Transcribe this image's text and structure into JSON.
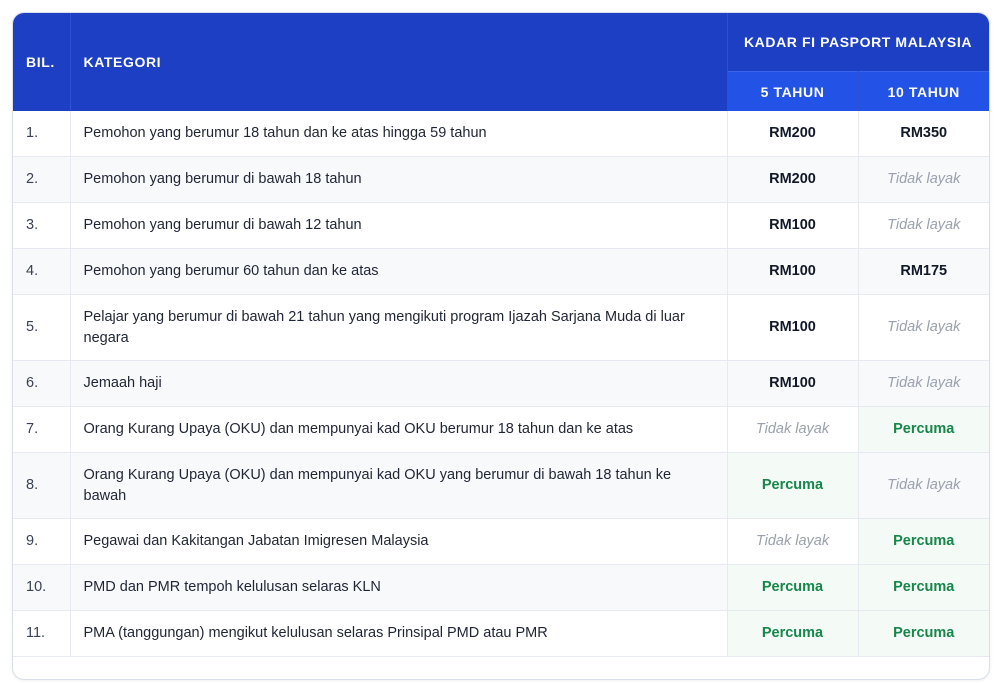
{
  "header": {
    "bil": "BIL.",
    "kategori": "KATEGORI",
    "fee_group": "KADAR FI PASPORT MALAYSIA",
    "col_5": "5 TAHUN",
    "col_10": "10 TAHUN"
  },
  "rows": [
    {
      "no": "1.",
      "category": "Pemohon yang berumur 18 tahun dan ke atas hingga 59 tahun",
      "fee5": "RM200",
      "fee10": "RM350"
    },
    {
      "no": "2.",
      "category": "Pemohon yang berumur di bawah 18 tahun",
      "fee5": "RM200",
      "fee10": "Tidak layak"
    },
    {
      "no": "3.",
      "category": "Pemohon yang berumur di bawah 12 tahun",
      "fee5": "RM100",
      "fee10": "Tidak layak"
    },
    {
      "no": "4.",
      "category": "Pemohon yang berumur 60 tahun dan ke atas",
      "fee5": "RM100",
      "fee10": "RM175"
    },
    {
      "no": "5.",
      "category": "Pelajar yang berumur di bawah 21 tahun yang mengikuti program Ijazah Sarjana Muda di luar negara",
      "fee5": "RM100",
      "fee10": "Tidak layak"
    },
    {
      "no": "6.",
      "category": "Jemaah haji",
      "fee5": "RM100",
      "fee10": "Tidak layak"
    },
    {
      "no": "7.",
      "category": "Orang Kurang Upaya (OKU) dan mempunyai kad OKU berumur 18 tahun dan ke atas",
      "fee5": "Tidak layak",
      "fee10": "Percuma"
    },
    {
      "no": "8.",
      "category": "Orang Kurang Upaya (OKU) dan mempunyai kad OKU yang berumur di bawah 18 tahun ke bawah",
      "fee5": "Percuma",
      "fee10": "Tidak layak"
    },
    {
      "no": "9.",
      "category": "Pegawai dan Kakitangan Jabatan Imigresen Malaysia",
      "fee5": "Tidak layak",
      "fee10": "Percuma"
    },
    {
      "no": "10.",
      "category": "PMD dan PMR tempoh kelulusan selaras KLN",
      "fee5": "Percuma",
      "fee10": "Percuma"
    },
    {
      "no": "11.",
      "category": "PMA (tanggungan) mengikut kelulusan selaras Prinsipal PMD atau PMR",
      "fee5": "Percuma",
      "fee10": "Percuma"
    }
  ],
  "colors": {
    "header_bg": "#1d3fc4",
    "subheader_bg": "#2352e6",
    "free_text": "#16864a",
    "na_text": "#9aa1ad"
  }
}
